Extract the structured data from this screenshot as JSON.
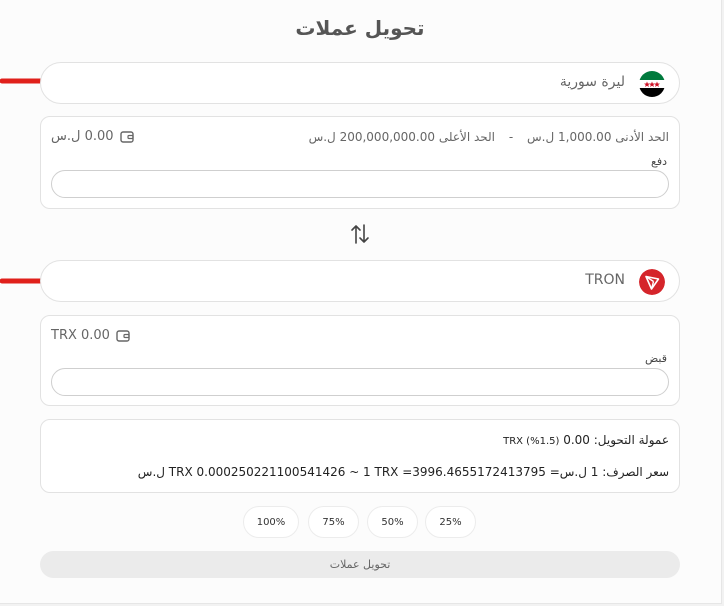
{
  "page": {
    "title": "تحويل عملات"
  },
  "from_currency": {
    "name": "ليرة سورية"
  },
  "pay_card": {
    "min_label": "الحد الأدنى",
    "min_value": "1,000.00 ل.س",
    "separator": "-",
    "max_label": "الحد الأعلى",
    "max_value": "200,000,000.00 ل.س",
    "balance": "0.00 ل.س",
    "field_label": "دفع",
    "input_value": "",
    "input_placeholder": ""
  },
  "to_currency": {
    "name": "TRON"
  },
  "receive_card": {
    "balance": "TRX 0.00",
    "field_label": "قبض",
    "input_value": "",
    "input_placeholder": ""
  },
  "info": {
    "commission_label": "عمولة التحويل:",
    "commission_value": "0.00",
    "commission_detail": "TRX (%1.5)",
    "rate_label": "سعر الصرف:",
    "rate_text": "1 ل.س= TRX 0.000250221100541426 ~ 1 TRX =3996.4655172413795 ل.س"
  },
  "percent_buttons": [
    "100%",
    "75%",
    "50%",
    "25%"
  ],
  "submit_label": "تحويل عملات",
  "colors": {
    "arrow_red": "#e0201b",
    "syria_green": "#007a3d",
    "tron_red": "#d5252b"
  }
}
